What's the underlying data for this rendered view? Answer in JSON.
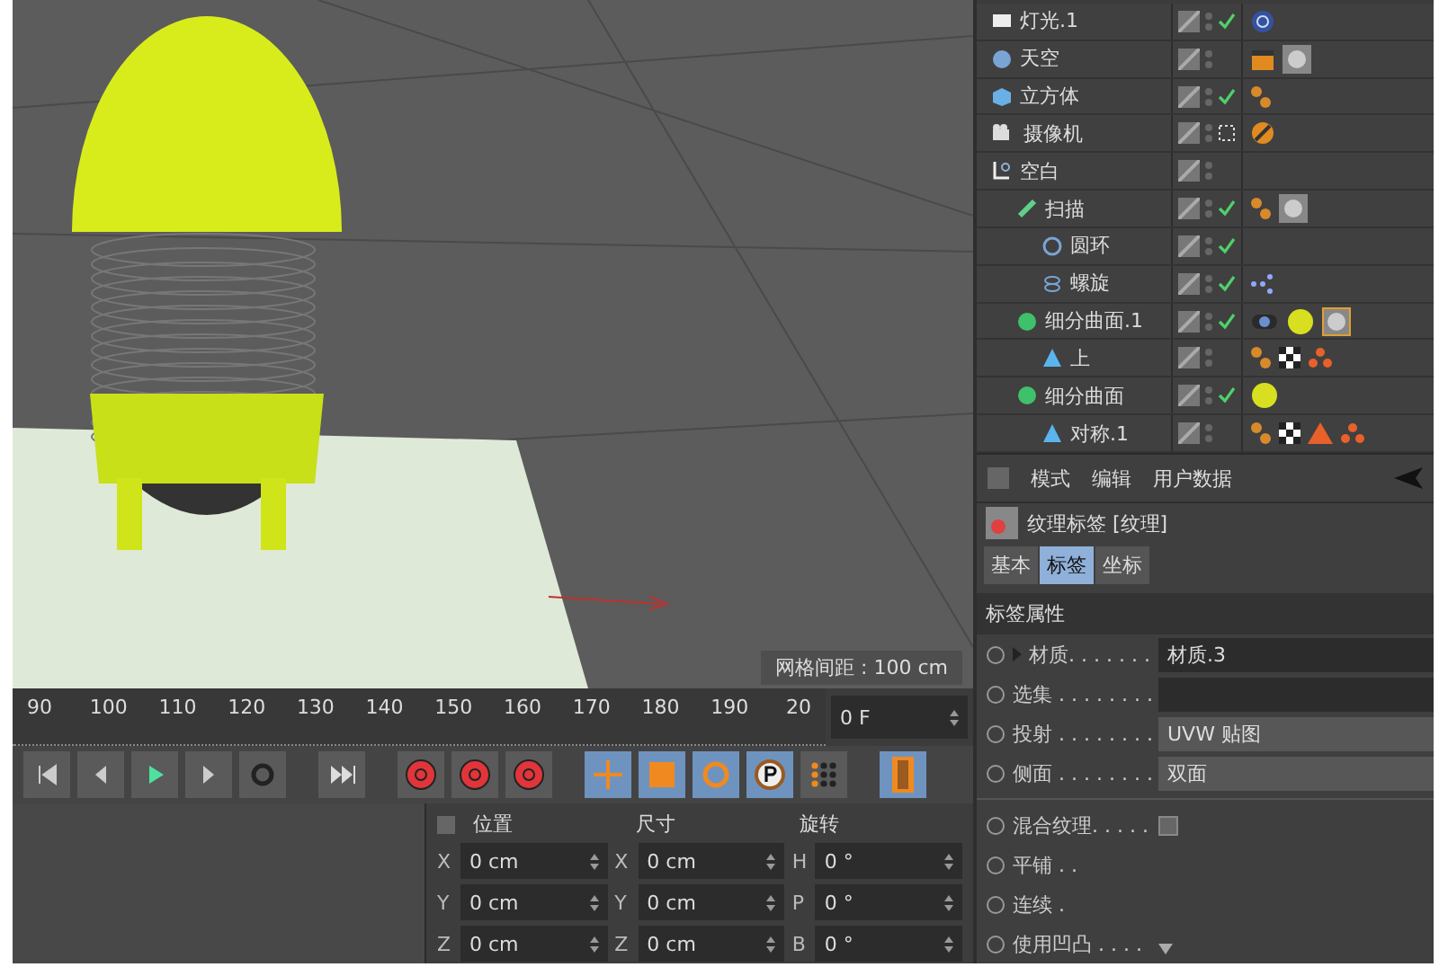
{
  "viewport": {
    "grid_label": "网格间距 : 100 cm"
  },
  "objects": [
    {
      "name": "灯光.1",
      "kind": "light",
      "checked": true,
      "tags": [
        {
          "kind": "target"
        }
      ]
    },
    {
      "name": "天空",
      "kind": "sky",
      "checked": false,
      "tags": [
        {
          "kind": "clapper"
        },
        {
          "kind": "texture"
        }
      ]
    },
    {
      "name": "立方体",
      "kind": "cube",
      "checked": true,
      "tags": [
        {
          "kind": "phong"
        }
      ]
    },
    {
      "name": "摄像机",
      "kind": "camera",
      "checked": false,
      "tags": [
        {
          "kind": "protect"
        }
      ]
    },
    {
      "name": "空白",
      "kind": "null",
      "checked": false,
      "children": [
        {
          "name": "扫描",
          "kind": "sweep",
          "checked": true,
          "tags": [
            {
              "kind": "phong"
            },
            {
              "kind": "texture"
            }
          ],
          "children": [
            {
              "name": "圆环",
              "kind": "circle",
              "checked": true
            },
            {
              "name": "螺旋",
              "kind": "helix",
              "checked": true,
              "tags": [
                {
                  "kind": "vertex"
                }
              ]
            }
          ]
        },
        {
          "name": "细分曲面.1",
          "kind": "subdivision",
          "checked": true,
          "tags": [
            {
              "kind": "display"
            },
            {
              "kind": "sphere"
            },
            {
              "kind": "texture-selected"
            }
          ],
          "children": [
            {
              "name": "上",
              "kind": "polygon",
              "checked": false,
              "tags": [
                {
                  "kind": "phong"
                },
                {
                  "kind": "checker"
                },
                {
                  "kind": "three-dots"
                }
              ]
            }
          ]
        },
        {
          "name": "细分曲面",
          "kind": "subdivision",
          "checked": true,
          "tags": [
            {
              "kind": "sphere"
            }
          ],
          "children": [
            {
              "name": "对称.1",
              "kind": "polygon",
              "checked": false,
              "tags": [
                {
                  "kind": "phong"
                },
                {
                  "kind": "checker"
                },
                {
                  "kind": "triangle"
                },
                {
                  "kind": "three-dots"
                }
              ]
            }
          ]
        }
      ]
    }
  ],
  "attributes": {
    "menu": [
      "模式",
      "编辑",
      "用户数据"
    ],
    "title": "纹理标签 [纹理]",
    "tabs": [
      {
        "label": "基本",
        "selected": false
      },
      {
        "label": "标签",
        "selected": true
      },
      {
        "label": "坐标",
        "selected": false
      }
    ],
    "section": "标签属性",
    "fields": [
      {
        "kind": "link",
        "label": "材质. . . . . . .",
        "value": "材质.3"
      },
      {
        "kind": "text",
        "label": "选集 . . . . . . . ."
      },
      {
        "kind": "select",
        "label": "投射 . . . . . . . .",
        "value": "UVW 贴图"
      },
      {
        "kind": "select",
        "label": "侧面 . . . . . . . .",
        "value": "双面"
      },
      {
        "kind": "divider"
      },
      {
        "kind": "checkbox",
        "label": "混合纹理. . . . .",
        "checked": false
      },
      {
        "kind": "plain",
        "label": "平铺 . ."
      },
      {
        "kind": "plain",
        "label": "连续 ."
      },
      {
        "kind": "toggle",
        "label": "使用凹凸 . . . ."
      }
    ]
  },
  "timeline": {
    "ticks": [
      "90",
      "100",
      "110",
      "120",
      "130",
      "140",
      "150",
      "160",
      "170",
      "180",
      "190",
      "20"
    ],
    "frame": "0 F"
  },
  "coordinates": {
    "headers": [
      "位置",
      "尺寸",
      "旋转"
    ],
    "rows": [
      [
        {
          "axis": "X",
          "value": "0 cm"
        },
        {
          "axis": "X",
          "value": "0 cm"
        },
        {
          "axis": "H",
          "value": "0 °"
        }
      ],
      [
        {
          "axis": "Y",
          "value": "0 cm"
        },
        {
          "axis": "Y",
          "value": "0 cm"
        },
        {
          "axis": "P",
          "value": "0 °"
        }
      ],
      [
        {
          "axis": "Z",
          "value": "0 cm"
        },
        {
          "axis": "Z",
          "value": "0 cm"
        },
        {
          "axis": "B",
          "value": "0 °"
        }
      ]
    ]
  }
}
